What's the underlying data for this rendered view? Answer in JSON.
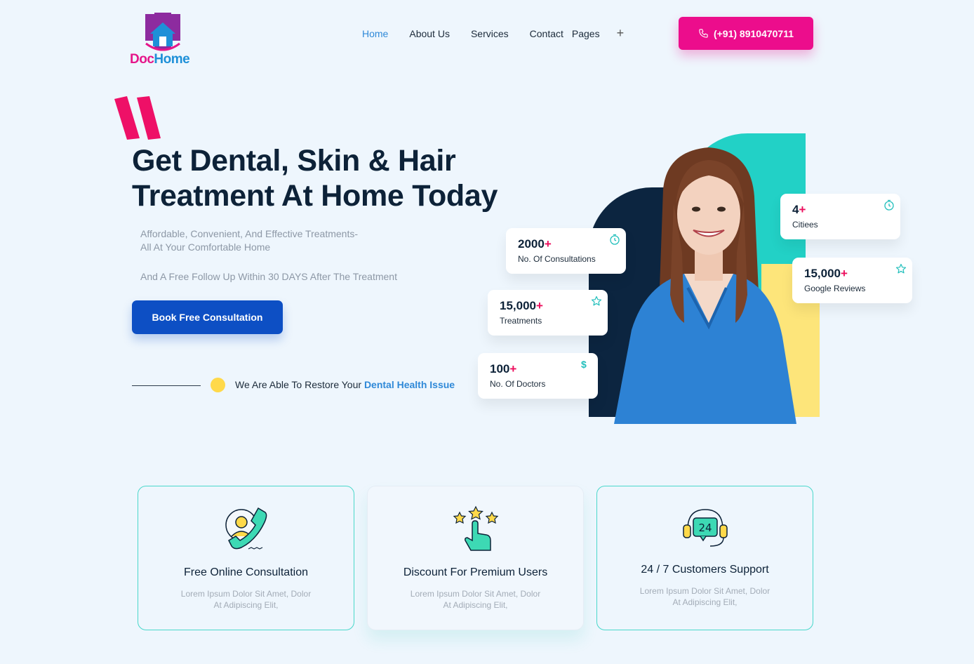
{
  "brand": {
    "logo_doc": "Doc",
    "logo_home": "Home",
    "primary_pink": "#ec0d8c",
    "primary_blue": "#0d4fc4",
    "accent_teal": "#22d1c6"
  },
  "nav": {
    "items": [
      "Home",
      "About Us",
      "Services",
      "Contact",
      "Pages"
    ],
    "active": "Home",
    "more_icon": "plus-icon"
  },
  "header": {
    "phone": "(+91) 8910470711"
  },
  "hero": {
    "title_line1": "Get Dental, Skin & Hair",
    "title_line2": "Treatment At Home Today",
    "subtitle_line1": "Affordable, Convenient, And Effective Treatments-",
    "subtitle_line2": "All At Your Comfortable Home",
    "subtitle2": "And A Free Follow Up Within 30 DAYS After The Treatment",
    "cta": "Book Free Consultation",
    "restore_text": "We Are Able To Restore Your ",
    "restore_highlight": "Dental Health Issue"
  },
  "stats": [
    {
      "number": "2000",
      "plus": "+",
      "label": "No. Of Consultations",
      "icon": "clock-icon"
    },
    {
      "number": "15,000",
      "plus": "+",
      "label": "Treatments",
      "icon": "star-icon"
    },
    {
      "number": "100",
      "plus": "+",
      "label": "No. Of Doctors",
      "icon": "dollar-icon"
    },
    {
      "number": "4",
      "plus": "+",
      "label": "Citiees",
      "icon": "clock-icon"
    },
    {
      "number": "15,000",
      "plus": "+",
      "label": "Google Reviews",
      "icon": "star-icon"
    }
  ],
  "features": [
    {
      "title": "Free Online Consultation",
      "desc_line1": "Lorem Ipsum Dolor Sit Amet, Dolor",
      "desc_line2": "At Adipiscing Elit,",
      "icon": "phone-consultation-icon"
    },
    {
      "title": "Discount For Premium Users",
      "desc_line1": "Lorem Ipsum Dolor Sit Amet, Dolor",
      "desc_line2": "At Adipiscing Elit,",
      "icon": "rating-stars-icon"
    },
    {
      "title": "24 / 7 Customers Support",
      "desc_line1": "Lorem Ipsum Dolor Sit Amet, Dolor",
      "desc_line2": "At Adipiscing Elit,",
      "icon": "headset-24-icon",
      "badge": "24"
    }
  ]
}
